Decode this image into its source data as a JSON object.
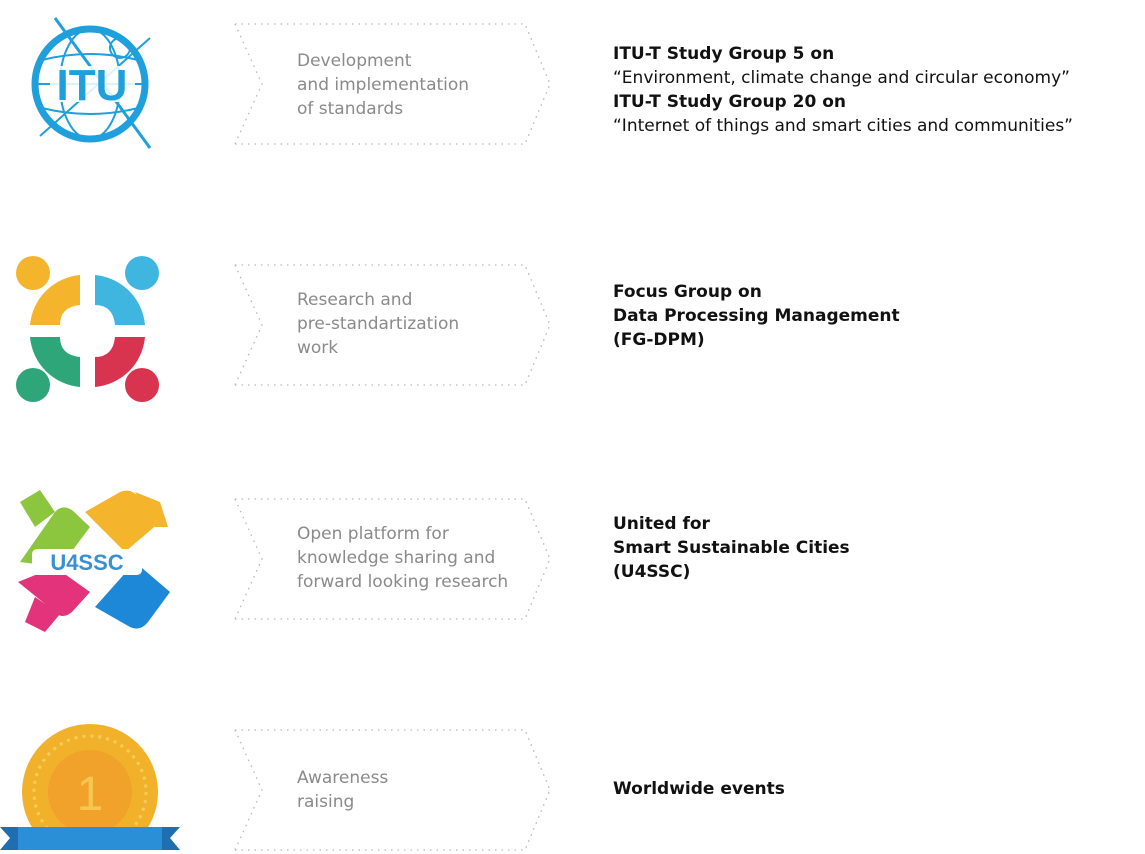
{
  "rows": [
    {
      "logo": "itu-logo",
      "logo_text": "ITU",
      "step": [
        "Development",
        "and implementation",
        "of standards"
      ],
      "desc": [
        {
          "text": "ITU-T Study Group 5 on",
          "bold": true
        },
        {
          "text": "“Environment, climate change and circular economy”",
          "bold": false
        },
        {
          "text": "ITU-T Study Group 20 on",
          "bold": true
        },
        {
          "text": "“Internet of things and smart cities and communities”",
          "bold": false
        }
      ]
    },
    {
      "logo": "focus-group-logo",
      "step": [
        "Research and",
        "pre-standartization",
        "work"
      ],
      "desc": [
        {
          "text": "Focus Group on",
          "bold": true
        },
        {
          "text": "Data Processing Management",
          "bold": true
        },
        {
          "text": "(FG-DPM)",
          "bold": true
        }
      ]
    },
    {
      "logo": "u4ssc-logo",
      "logo_text": "U4SSC",
      "step": [
        "Open platform for",
        "knowledge sharing and",
        "forward looking research"
      ],
      "desc": [
        {
          "text": "United for",
          "bold": true
        },
        {
          "text": "Smart Sustainable Cities",
          "bold": true
        },
        {
          "text": "(U4SSC)",
          "bold": true
        }
      ]
    },
    {
      "logo": "medal-icon",
      "logo_text": "1",
      "step": [
        "Awareness",
        "raising"
      ],
      "desc": [
        {
          "text": "Worldwide events",
          "bold": true
        }
      ]
    }
  ],
  "colors": {
    "itu_blue": "#1fa0dc",
    "yellow": "#f4b52c",
    "cyan": "#3fb6e0",
    "green": "#2fa57a",
    "red": "#d8344f",
    "lime": "#8cc63f",
    "magenta": "#e3337a",
    "blue": "#1e88d8",
    "gold": "#f2b12a",
    "ribbon": "#2b8fd8"
  }
}
